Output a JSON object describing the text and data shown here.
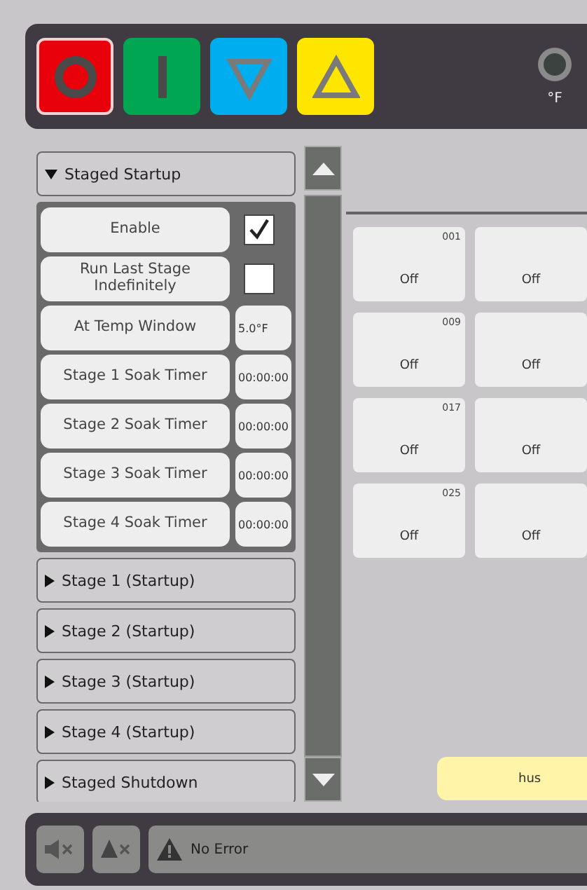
{
  "mode_buttons": [
    {
      "kind": "stop",
      "color": "#e8000b",
      "selected": true
    },
    {
      "kind": "run",
      "color": "#00a651",
      "selected": false
    },
    {
      "kind": "down",
      "color": "#00aeef",
      "selected": false
    },
    {
      "kind": "up",
      "color": "#ffe600",
      "selected": false
    }
  ],
  "unit_label": "°F",
  "sections": [
    {
      "title": "Staged Startup",
      "expanded": true,
      "rows": [
        {
          "label": "Enable",
          "kind": "checkbox",
          "checked": true
        },
        {
          "label": "Run Last Stage Indefinitely",
          "kind": "checkbox",
          "checked": false
        },
        {
          "label": "At Temp Window",
          "kind": "value",
          "value": "5.0°F"
        },
        {
          "label": "Stage 1 Soak Timer",
          "kind": "value",
          "value": "00:00:00"
        },
        {
          "label": "Stage 2 Soak Timer",
          "kind": "value",
          "value": "00:00:00"
        },
        {
          "label": "Stage 3 Soak Timer",
          "kind": "value",
          "value": "00:00:00"
        },
        {
          "label": "Stage 4 Soak Timer",
          "kind": "value",
          "value": "00:00:00"
        }
      ]
    },
    {
      "title": "Stage 1 (Startup)",
      "expanded": false
    },
    {
      "title": "Stage 2 (Startup)",
      "expanded": false
    },
    {
      "title": "Stage 3 (Startup)",
      "expanded": false
    },
    {
      "title": "Stage 4 (Startup)",
      "expanded": false
    },
    {
      "title": "Staged Shutdown",
      "expanded": false
    }
  ],
  "tiles": [
    {
      "number": "001",
      "state": "Off"
    },
    {
      "state": "Off"
    },
    {
      "number": "009",
      "state": "Off"
    },
    {
      "state": "Off"
    },
    {
      "number": "017",
      "state": "Off"
    },
    {
      "state": "Off"
    },
    {
      "number": "025",
      "state": "Off"
    },
    {
      "state": "Off"
    }
  ],
  "hush_button": "hus",
  "status": {
    "message": "No Error"
  }
}
